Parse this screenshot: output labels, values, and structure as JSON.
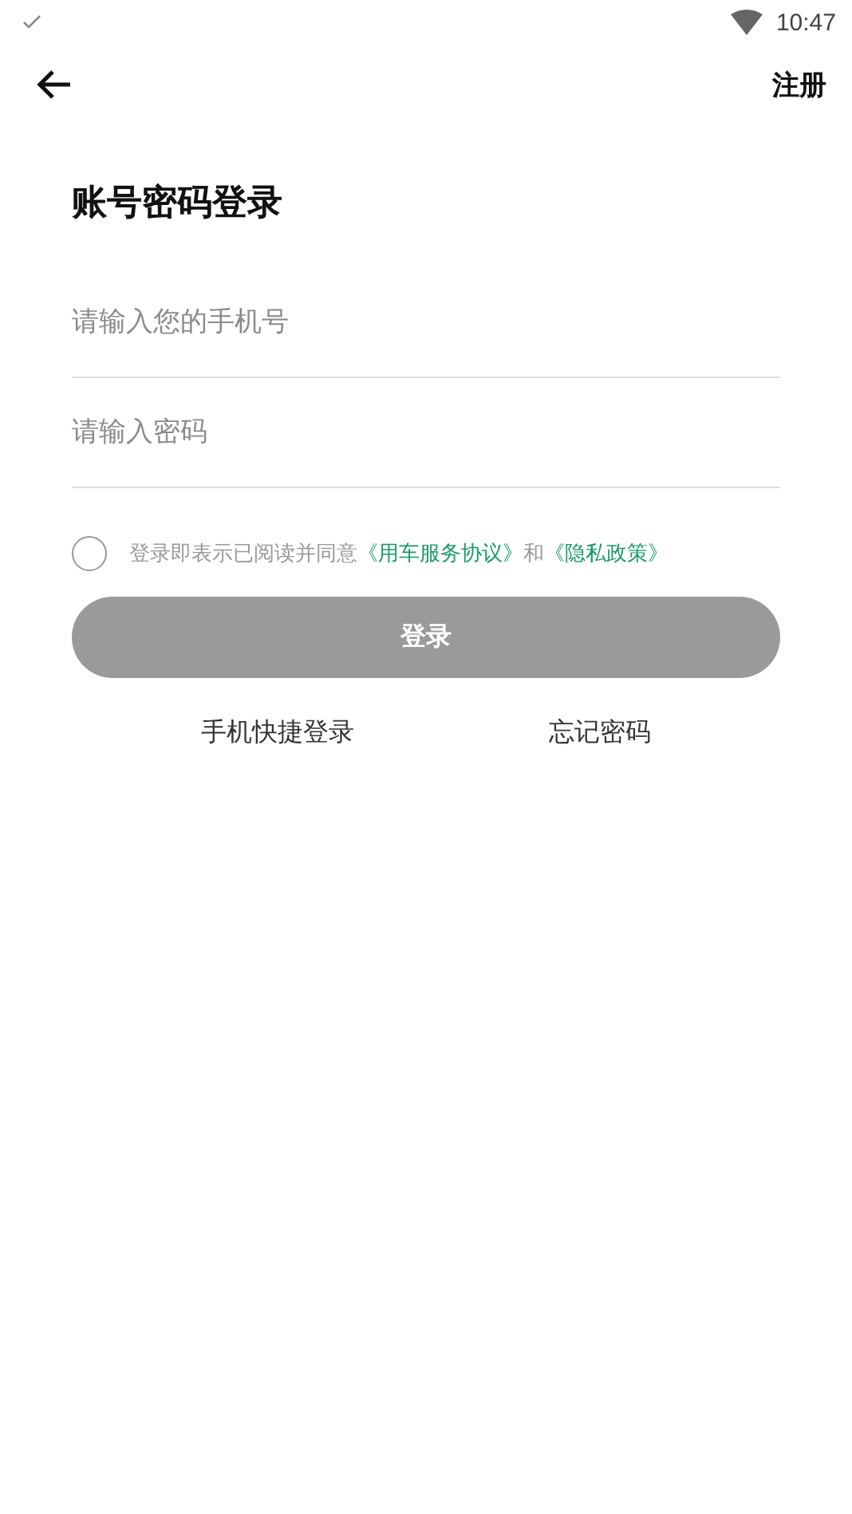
{
  "status_bar": {
    "time": "10:47"
  },
  "header": {
    "action": "注册"
  },
  "title": "账号密码登录",
  "fields": [
    {
      "placeholder": "请输入您的手机号"
    },
    {
      "placeholder": "请输入密码"
    }
  ],
  "agreement": {
    "checked": false,
    "text": "登录即表示已阅读并同意",
    "links": [
      "《用车服务协议》",
      "《隐私政策》"
    ],
    "joiner": "和"
  },
  "login_button": {
    "label": "登录",
    "disabled": true
  },
  "links": [
    "手机快捷登录",
    "忘记密码"
  ]
}
